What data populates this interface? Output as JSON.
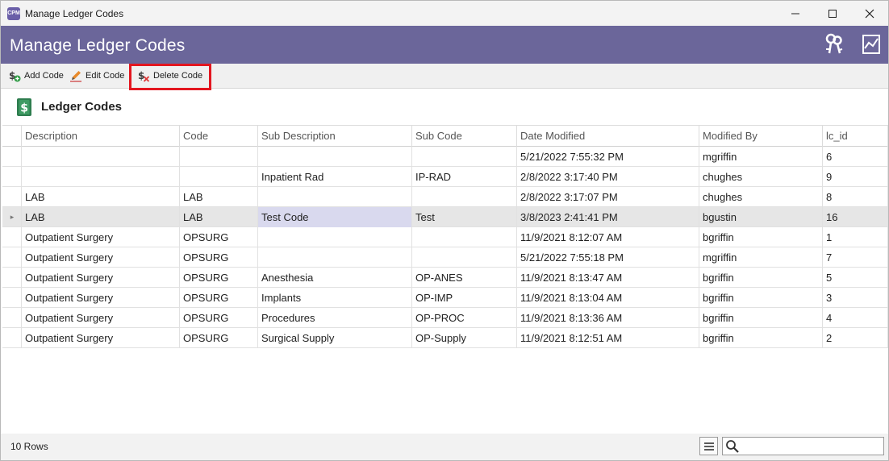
{
  "window": {
    "title": "Manage Ledger Codes",
    "app_icon_text": "CPM"
  },
  "header": {
    "title": "Manage Ledger Codes"
  },
  "toolbar": {
    "add_label": "Add Code",
    "edit_label": "Edit Code",
    "delete_label": "Delete Code"
  },
  "section": {
    "title": "Ledger Codes"
  },
  "grid": {
    "columns": [
      "Description",
      "Code",
      "Sub Description",
      "Sub Code",
      "Date Modified",
      "Modified By",
      "lc_id"
    ],
    "rows": [
      [
        "",
        "",
        "",
        "",
        "5/21/2022 7:55:32 PM",
        "mgriffin",
        "6"
      ],
      [
        "",
        "",
        "Inpatient Rad",
        "IP-RAD",
        "2/8/2022 3:17:40 PM",
        "chughes",
        "9"
      ],
      [
        "LAB",
        "LAB",
        "",
        "",
        "2/8/2022 3:17:07 PM",
        "chughes",
        "8"
      ],
      [
        "LAB",
        "LAB",
        "Test Code",
        "Test",
        "3/8/2023 2:41:41 PM",
        "bgustin",
        "16"
      ],
      [
        "Outpatient Surgery",
        "OPSURG",
        "",
        "",
        "11/9/2021 8:12:07 AM",
        "bgriffin",
        "1"
      ],
      [
        "Outpatient Surgery",
        "OPSURG",
        "",
        "",
        "5/21/2022 7:55:18 PM",
        "mgriffin",
        "7"
      ],
      [
        "Outpatient Surgery",
        "OPSURG",
        "Anesthesia",
        "OP-ANES",
        "11/9/2021 8:13:47 AM",
        "bgriffin",
        "5"
      ],
      [
        "Outpatient Surgery",
        "OPSURG",
        "Implants",
        "OP-IMP",
        "11/9/2021 8:13:04 AM",
        "bgriffin",
        "3"
      ],
      [
        "Outpatient Surgery",
        "OPSURG",
        "Procedures",
        "OP-PROC",
        "11/9/2021 8:13:36 AM",
        "bgriffin",
        "4"
      ],
      [
        "Outpatient Surgery",
        "OPSURG",
        "Surgical Supply",
        "OP-Supply",
        "11/9/2021 8:12:51 AM",
        "bgriffin",
        "2"
      ]
    ]
  },
  "status": {
    "row_count": "10 Rows",
    "search_value": "",
    "search_placeholder": ""
  },
  "colors": {
    "header_band": "#6b669a",
    "highlight_border": "#e3161f",
    "selected_row": "#e6e6e6",
    "focused_cell": "#d9d9ee"
  },
  "icons": {
    "add": "dollar-add-icon",
    "edit": "pencil-icon",
    "delete": "dollar-delete-icon",
    "keys": "keys-icon",
    "chart": "chart-icon",
    "ledger": "ledger-dollar-icon",
    "menu": "hamburger-menu-icon",
    "search": "search-icon"
  }
}
